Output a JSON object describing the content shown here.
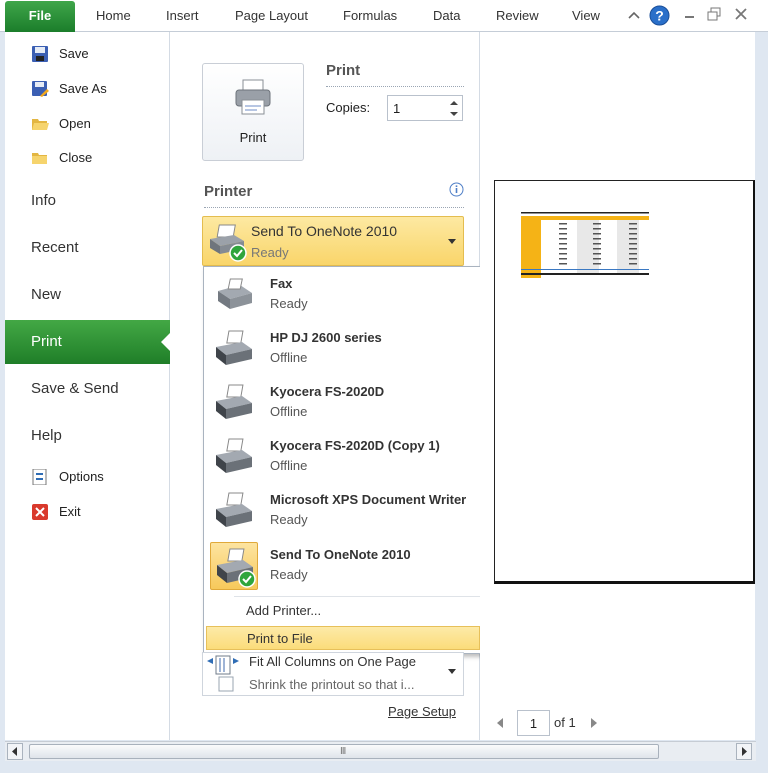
{
  "ribbon": {
    "file_tab": "File",
    "tabs": [
      "Home",
      "Insert",
      "Page Layout",
      "Formulas",
      "Data",
      "Review",
      "View"
    ]
  },
  "backstage_nav": {
    "commands": {
      "save": "Save",
      "save_as": "Save As",
      "open": "Open",
      "close": "Close"
    },
    "tabs": {
      "info": "Info",
      "recent": "Recent",
      "new": "New",
      "print": "Print",
      "save_send": "Save & Send",
      "help": "Help"
    },
    "bottom_commands": {
      "options": "Options",
      "exit": "Exit"
    }
  },
  "print_panel": {
    "print_button": "Print",
    "print_heading": "Print",
    "copies_label": "Copies:",
    "copies_value": "1",
    "printer_heading": "Printer",
    "selected_printer": {
      "name": "Send To OneNote 2010",
      "status": "Ready"
    },
    "printers": [
      {
        "name": "Fax",
        "status": "Ready"
      },
      {
        "name": "HP DJ 2600 series",
        "status": "Offline"
      },
      {
        "name": "Kyocera FS-2020D",
        "status": "Offline"
      },
      {
        "name": "Kyocera FS-2020D (Copy 1)",
        "status": "Offline"
      },
      {
        "name": "Microsoft XPS Document Writer",
        "status": "Ready"
      },
      {
        "name": "Send To OneNote 2010",
        "status": "Ready"
      }
    ],
    "add_printer": "Add Printer...",
    "print_to_file": "Print to File",
    "scaling": {
      "main": "Fit All Columns on One Page",
      "sub": "Shrink the printout so that i..."
    },
    "page_setup": "Page Setup"
  },
  "preview": {
    "page_current": "1",
    "page_of": "of 1"
  },
  "scrollbar": {
    "grip": "III"
  },
  "colors": {
    "file_green": "#1b7d2b",
    "print_selected_green": "#2f942f",
    "selection_yellow": "#f9d56a"
  }
}
